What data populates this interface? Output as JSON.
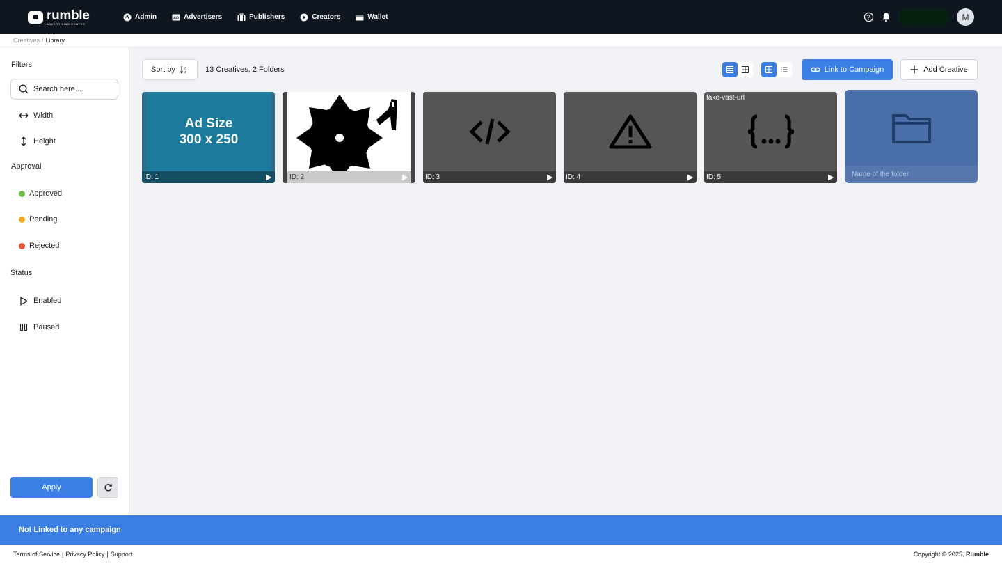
{
  "brand": {
    "name": "rumble",
    "subtitle": "ADVERTISING CENTER"
  },
  "nav": {
    "items": [
      {
        "label": "Admin",
        "icon": "admin-icon"
      },
      {
        "label": "Advertisers",
        "icon": "ad-icon"
      },
      {
        "label": "Publishers",
        "icon": "briefcase-icon"
      },
      {
        "label": "Creators",
        "icon": "play-circle-icon"
      },
      {
        "label": "Wallet",
        "icon": "wallet-icon"
      }
    ],
    "avatar_initial": "M"
  },
  "breadcrumb": {
    "parent": "Creatives",
    "separator": "/",
    "current": "Library"
  },
  "sidebar": {
    "filters_heading": "Filters",
    "search_placeholder": "Search here...",
    "width_label": "Width",
    "height_label": "Height",
    "approval_heading": "Approval",
    "approval": [
      {
        "label": "Approved",
        "color": "#6cc04a"
      },
      {
        "label": "Pending",
        "color": "#f5a623"
      },
      {
        "label": "Rejected",
        "color": "#e8503a"
      }
    ],
    "status_heading": "Status",
    "status": [
      {
        "label": "Enabled",
        "icon": "play-outline-icon"
      },
      {
        "label": "Paused",
        "icon": "pause-outline-icon"
      }
    ],
    "apply_label": "Apply"
  },
  "toolbar": {
    "sort_label": "Sort by",
    "count_text": "13 Creatives, 2 Folders",
    "link_label": "Link to Campaign",
    "add_label": "Add Creative"
  },
  "creatives": [
    {
      "id": "ID: 1",
      "type": "image",
      "image_text_line1": "Ad Size",
      "image_text_line2": "300 x 250"
    },
    {
      "id": "ID: 2",
      "type": "image"
    },
    {
      "id": "ID: 3",
      "type": "code",
      "icon": "code-icon"
    },
    {
      "id": "ID: 4",
      "type": "warning",
      "icon": "warning-icon"
    },
    {
      "id": "ID: 5",
      "type": "vast",
      "label": "fake-vast-url",
      "icon": "braces-icon"
    }
  ],
  "folder": {
    "name": "Name of the folder",
    "icon": "folder-icon"
  },
  "banner": {
    "text": "Not Linked to any campaign"
  },
  "footer": {
    "links": [
      "Terms of Service",
      "Privacy Policy",
      "Support"
    ],
    "copyright": "Copyright © 2025,",
    "copyright_brand": "Rumble"
  },
  "colors": {
    "accent": "#3b7ee4",
    "nav_bg": "#0e1620"
  }
}
